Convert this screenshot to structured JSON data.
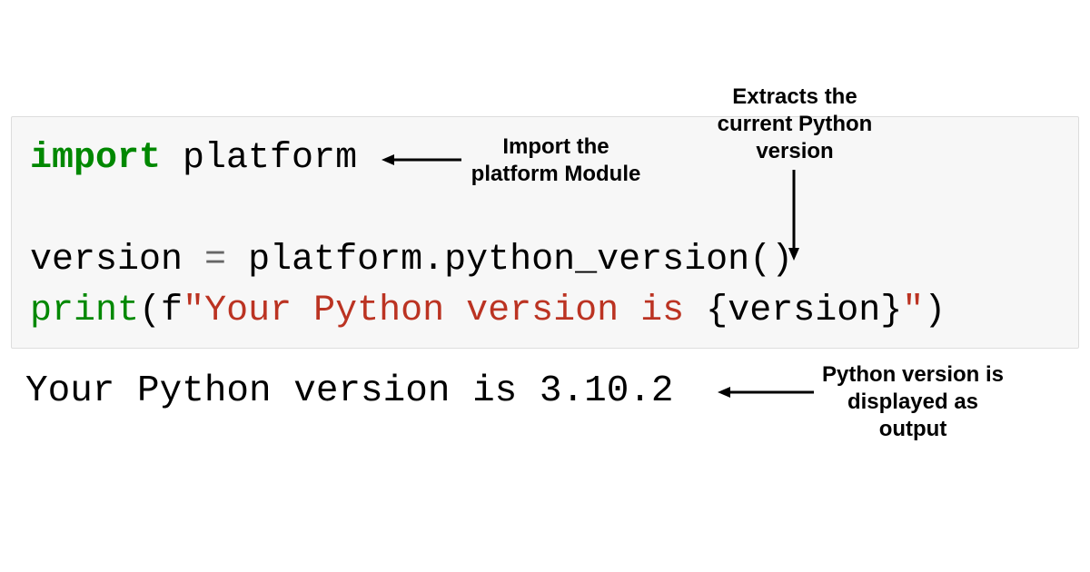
{
  "code": {
    "line1": {
      "keyword": "import",
      "module": " platform"
    },
    "line2": {
      "assign": "version ",
      "equals": "=",
      "space": " ",
      "call": "platform.python_version",
      "parens": "()"
    },
    "line3": {
      "func": "print",
      "open": "(",
      "fprefix": "f",
      "quote1": "\"",
      "str1": "Your Python version is ",
      "brace_open": "{",
      "expr": "version",
      "brace_close": "}",
      "quote2": "\"",
      "close": ")"
    }
  },
  "output": "Your Python version is 3.10.2",
  "annotations": {
    "a1": "Import the platform Module",
    "a2": "Extracts the current Python version",
    "a3": "Python version is displayed as output"
  }
}
